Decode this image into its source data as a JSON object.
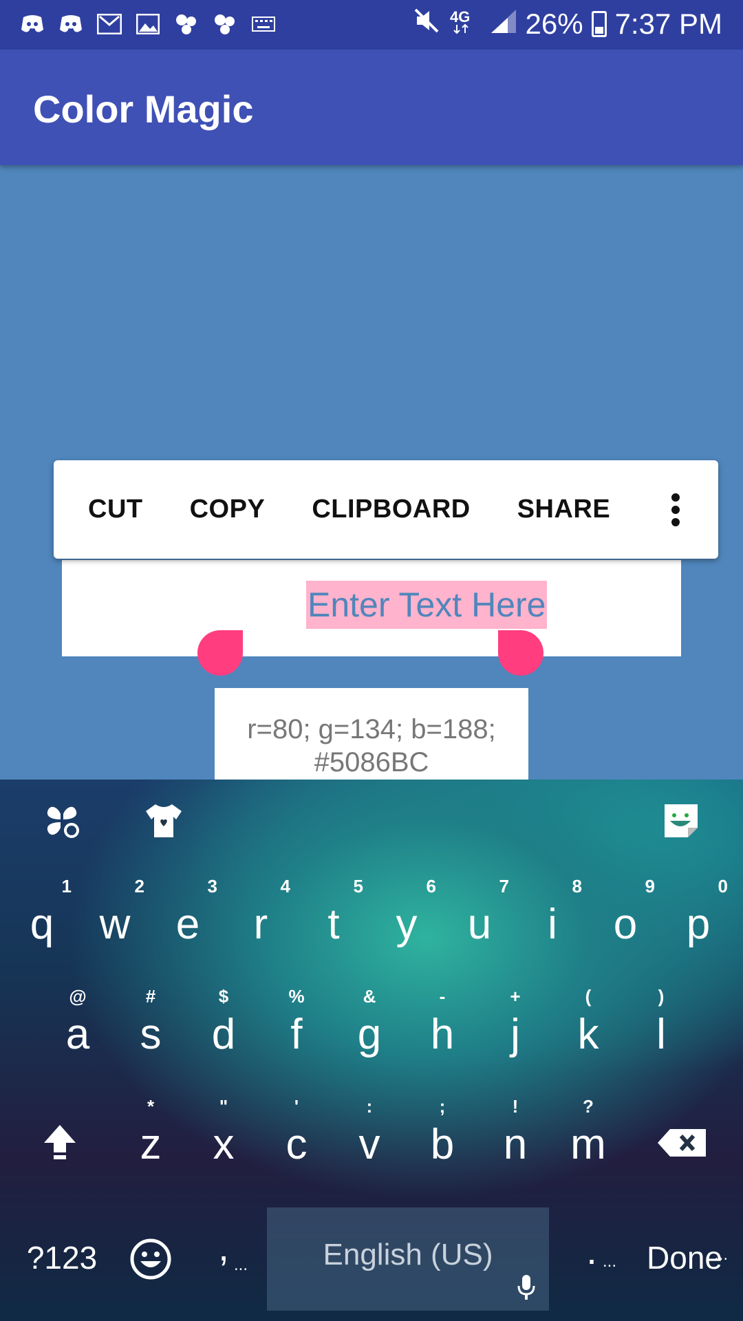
{
  "status_bar": {
    "left_icons": [
      "discord-icon",
      "discord-icon",
      "gmail-icon",
      "gallery-icon",
      "app-icon",
      "app-icon",
      "keyboard-icon"
    ],
    "right_icons": [
      "mute-icon",
      "network-4g-lte-icon",
      "signal-icon"
    ],
    "battery": "26%",
    "time": "7:37 PM"
  },
  "app_bar": {
    "title": "Color Magic"
  },
  "text_field": {
    "value": "Enter Text Here"
  },
  "selection_popup": {
    "items": [
      "CUT",
      "COPY",
      "CLIPBOARD",
      "SHARE"
    ],
    "more_icon": "more-vert-icon"
  },
  "color_readout": {
    "line1": "r=80; g=134; b=188;",
    "line2": "#5086BC"
  },
  "keyboard": {
    "top_icons": [
      "apps-icon",
      "theme-shirt-icon",
      "sticker-icon"
    ],
    "row1": [
      {
        "hint": "1",
        "key": "q"
      },
      {
        "hint": "2",
        "key": "w"
      },
      {
        "hint": "3",
        "key": "e"
      },
      {
        "hint": "4",
        "key": "r"
      },
      {
        "hint": "5",
        "key": "t"
      },
      {
        "hint": "6",
        "key": "y"
      },
      {
        "hint": "7",
        "key": "u"
      },
      {
        "hint": "8",
        "key": "i"
      },
      {
        "hint": "9",
        "key": "o"
      },
      {
        "hint": "0",
        "key": "p"
      }
    ],
    "row2": [
      {
        "hint": "@",
        "key": "a"
      },
      {
        "hint": "#",
        "key": "s"
      },
      {
        "hint": "$",
        "key": "d"
      },
      {
        "hint": "%",
        "key": "f"
      },
      {
        "hint": "&",
        "key": "g"
      },
      {
        "hint": "-",
        "key": "h"
      },
      {
        "hint": "+",
        "key": "j"
      },
      {
        "hint": "(",
        "key": "k"
      },
      {
        "hint": ")",
        "key": "l"
      }
    ],
    "row3": [
      {
        "hint": "*",
        "key": "z"
      },
      {
        "hint": "\"",
        "key": "x"
      },
      {
        "hint": "'",
        "key": "c"
      },
      {
        "hint": ":",
        "key": "v"
      },
      {
        "hint": ";",
        "key": "b"
      },
      {
        "hint": "!",
        "key": "n"
      },
      {
        "hint": "?",
        "key": "m"
      }
    ],
    "symbols_key": "?123",
    "comma_key": ",",
    "space_label": "English (US)",
    "period_key": ".",
    "done_key": "Done",
    "long_press_dots": "..."
  }
}
